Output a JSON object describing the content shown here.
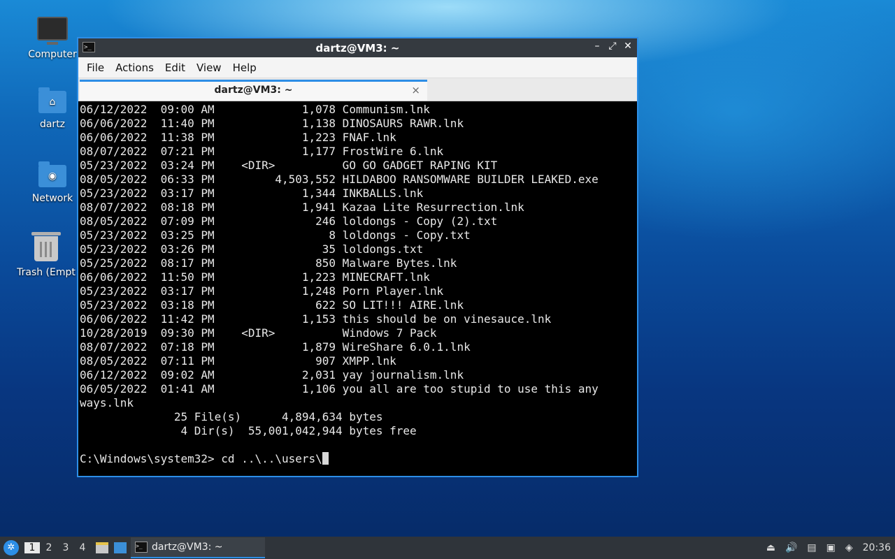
{
  "desktop": {
    "icons": [
      {
        "label": "Computer",
        "icon": "computer-icon"
      },
      {
        "label": "dartz",
        "icon": "home-folder-icon"
      },
      {
        "label": "Network",
        "icon": "network-folder-icon"
      },
      {
        "label": "Trash (Empt",
        "icon": "trash-icon"
      }
    ]
  },
  "window": {
    "title": "dartz@VM3: ~",
    "controls": {
      "minimize": "–",
      "maximize": "⤢",
      "close": "✕"
    },
    "menu": [
      "File",
      "Actions",
      "Edit",
      "View",
      "Help"
    ],
    "tab": {
      "label": "dartz@VM3: ~",
      "close": "×"
    }
  },
  "terminal": {
    "lines": [
      "06/12/2022  09:00 AM             1,078 Communism.lnk",
      "06/06/2022  11:40 PM             1,138 DINOSAURS RAWR.lnk",
      "06/06/2022  11:38 PM             1,223 FNAF.lnk",
      "08/07/2022  07:21 PM             1,177 FrostWire 6.lnk",
      "05/23/2022  03:24 PM    <DIR>          GO GO GADGET RAPING KIT",
      "08/05/2022  06:33 PM         4,503,552 HILDABOO RANSOMWARE BUILDER LEAKED.exe",
      "05/23/2022  03:17 PM             1,344 INKBALLS.lnk",
      "08/07/2022  08:18 PM             1,941 Kazaa Lite Resurrection.lnk",
      "08/05/2022  07:09 PM               246 loldongs - Copy (2).txt",
      "05/23/2022  03:25 PM                 8 loldongs - Copy.txt",
      "05/23/2022  03:26 PM                35 loldongs.txt",
      "05/25/2022  08:17 PM               850 Malware Bytes.lnk",
      "06/06/2022  11:50 PM             1,223 MINECRAFT.lnk",
      "05/23/2022  03:17 PM             1,248 Porn Player.lnk",
      "05/23/2022  03:18 PM               622 SO LIT!!! AIRE.lnk",
      "06/06/2022  11:42 PM             1,153 this should be on vinesauce.lnk",
      "10/28/2019  09:30 PM    <DIR>          Windows 7 Pack",
      "08/07/2022  07:18 PM             1,879 WireShare 6.0.1.lnk",
      "08/05/2022  07:11 PM               907 XMPP.lnk",
      "06/12/2022  09:02 AM             2,031 yay journalism.lnk",
      "06/05/2022  01:41 AM             1,106 you all are too stupid to use this any",
      "ways.lnk",
      "              25 File(s)      4,894,634 bytes",
      "               4 Dir(s)  55,001,042,944 bytes free",
      ""
    ],
    "prompt": "C:\\Windows\\system32> cd ..\\..\\users\\"
  },
  "taskbar": {
    "workspaces": [
      "1",
      "2",
      "3",
      "4"
    ],
    "active_workspace": "1",
    "task_label": "dartz@VM3: ~",
    "clock": "20:36"
  }
}
